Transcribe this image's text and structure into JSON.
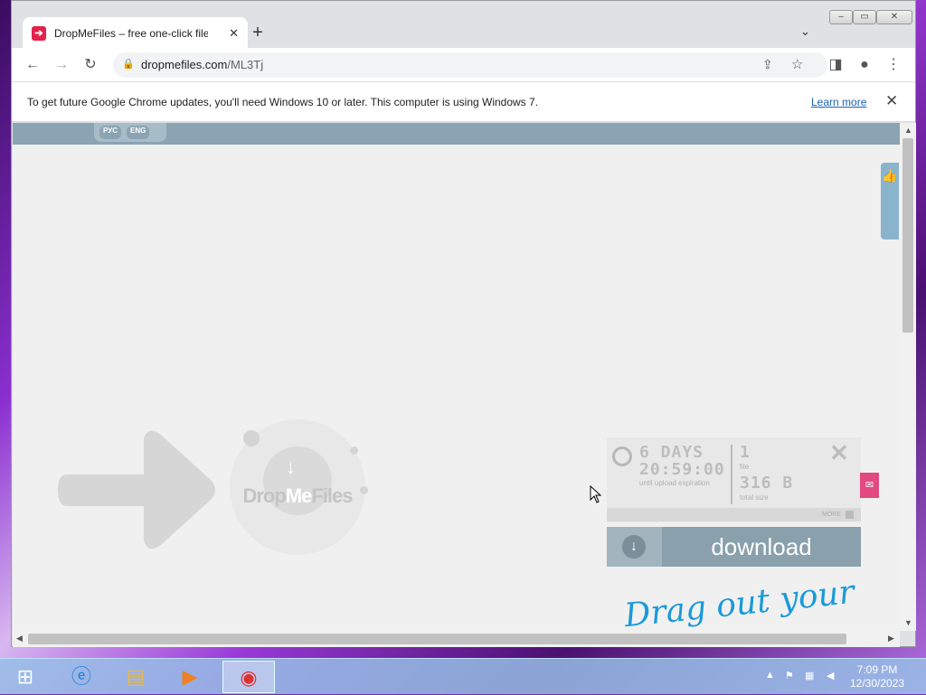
{
  "tab": {
    "title": "DropMeFiles – free one-click file",
    "favicon": "arrow-icon",
    "close": "✕"
  },
  "newtab_label": "+",
  "address": {
    "host": "dropmefiles.com",
    "path": "/ML3Tj"
  },
  "infobar": {
    "message": "To get future Google Chrome updates, you'll need Windows 10 or later. This computer is using Windows 7.",
    "link": "Learn more"
  },
  "page": {
    "languages": [
      "РУС",
      "ENG"
    ],
    "logo": {
      "part1": "Drop",
      "part2": "Me",
      "part3": "Files"
    },
    "stats": {
      "days": "6 DAYS",
      "time": "20:59:00",
      "time_caption": "until upload expiration",
      "file_count": "1",
      "file_caption": "file",
      "size": "316 B",
      "size_caption": "total size",
      "more": "MORE"
    },
    "download_label": "download",
    "drag_text": "Drag out your"
  },
  "taskbar": {
    "time": "7:09 PM",
    "date": "12/30/2023"
  },
  "colors": {
    "accent": "#e2234c",
    "download": "#8aa0ac",
    "drag": "#1a9ad8"
  }
}
